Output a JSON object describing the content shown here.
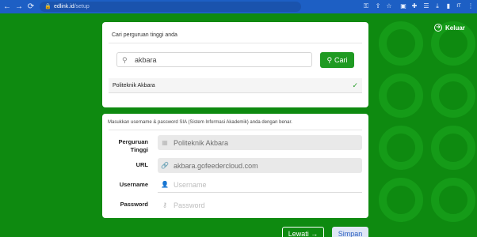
{
  "browser": {
    "url_host": "edlink.id",
    "url_path": "/setup",
    "profile_label": "IT",
    "icons": [
      "back-icon",
      "forward-icon",
      "reload-icon",
      "lock-icon",
      "key-icon",
      "share-icon",
      "star-icon",
      "extension-icon",
      "puzzle-icon",
      "menu-icon",
      "download-icon",
      "sidepanel-icon",
      "kebab-icon"
    ]
  },
  "header": {
    "logout_label": "Keluar"
  },
  "search": {
    "title": "Cari perguruan tinggi anda",
    "value": "akbara",
    "button_label": "Cari",
    "result": "Politeknik Akbara"
  },
  "form": {
    "instruction": "Masukkan username & password SIA (Sistem Informasi Akademik) anda dengan benar.",
    "institution_label_line1": "Perguruan",
    "institution_label_line2": "Tinggi",
    "institution_value": "Politeknik Akbara",
    "url_label": "URL",
    "url_value": "akbara.gofeedercloud.com",
    "username_label": "Username",
    "username_placeholder": "Username",
    "password_label": "Password",
    "password_placeholder": "Password"
  },
  "actions": {
    "skip_label": "Lewati →",
    "save_label": "Simpan"
  },
  "colors": {
    "background": "#0e8a10",
    "accent": "#1f9a22",
    "chrome": "#1d5fc4"
  }
}
